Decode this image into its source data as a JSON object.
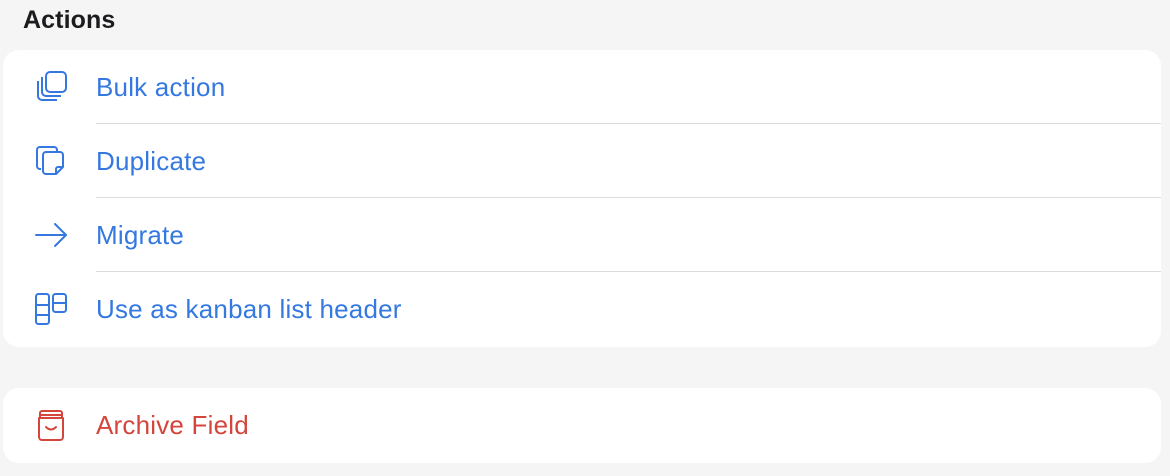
{
  "section": {
    "title": "Actions"
  },
  "actions": [
    {
      "label": "Bulk action",
      "icon": "stacked-copies-icon"
    },
    {
      "label": "Duplicate",
      "icon": "duplicate-document-icon"
    },
    {
      "label": "Migrate",
      "icon": "arrow-right-icon"
    },
    {
      "label": "Use as kanban list header",
      "icon": "kanban-columns-icon"
    }
  ],
  "danger": {
    "label": "Archive Field",
    "icon": "archive-box-icon"
  },
  "colors": {
    "accent": "#3478e0",
    "destructive": "#d4463c",
    "background": "#f5f5f5",
    "card": "#ffffff"
  }
}
